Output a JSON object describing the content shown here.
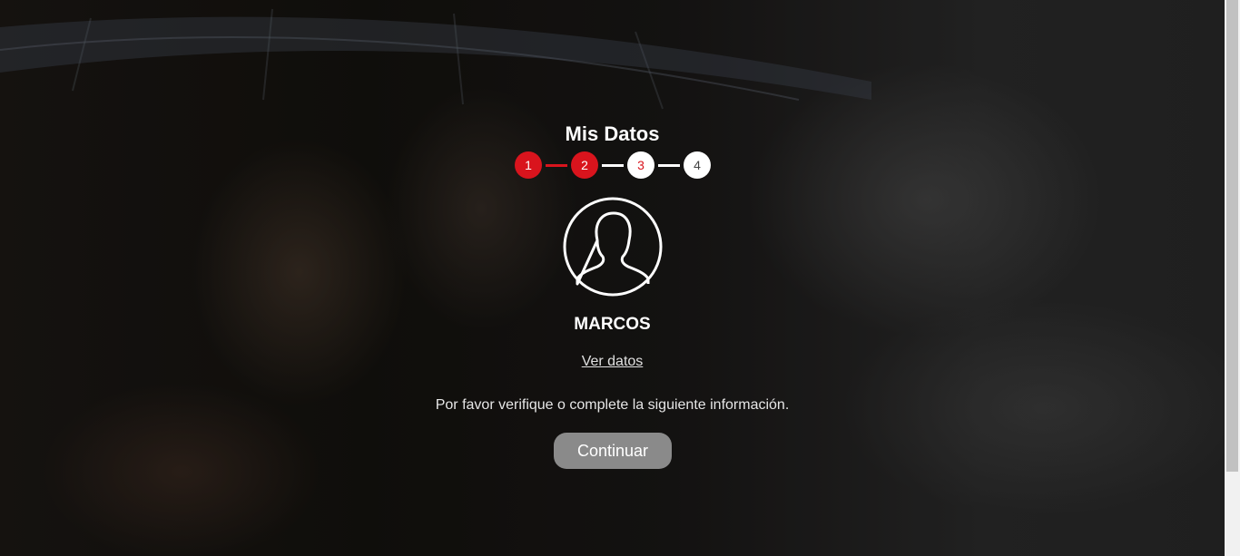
{
  "page": {
    "title": "Mis Datos"
  },
  "stepper": {
    "steps": [
      {
        "label": "1",
        "state": "done"
      },
      {
        "label": "2",
        "state": "active"
      },
      {
        "label": "3",
        "state": "pending"
      },
      {
        "label": "4",
        "state": "pending"
      }
    ]
  },
  "profile": {
    "icon": "user-silhouette-icon",
    "name": "MARCOS",
    "view_link": "Ver datos"
  },
  "message": "Por favor verifique o complete la siguiente información.",
  "actions": {
    "continue_label": "Continuar"
  },
  "colors": {
    "accent": "#d9141d",
    "button": "#8a8a8a"
  }
}
